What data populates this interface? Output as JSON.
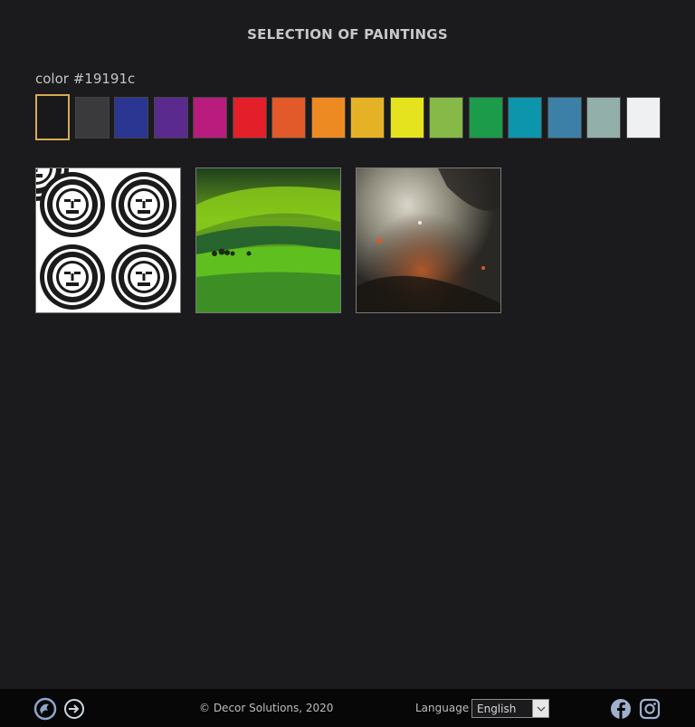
{
  "header": {
    "title": "SELECTION OF PAINTINGS"
  },
  "color_picker": {
    "label": "color #19191c",
    "selected": "#19191c",
    "swatches": [
      "#19191c",
      "#3a3a3c",
      "#2b3592",
      "#5a2a8e",
      "#b81d7e",
      "#e3202a",
      "#e2592a",
      "#ed8b22",
      "#e6b225",
      "#e5e31e",
      "#86b948",
      "#1c9b4b",
      "#0c95ab",
      "#3d80a7",
      "#93afa9",
      "#eff0f2"
    ]
  },
  "gallery": {
    "paintings": [
      {
        "icon": "tribal-sun-masks-painting"
      },
      {
        "icon": "green-hills-landscape-painting"
      },
      {
        "icon": "abstract-rust-texture-painting"
      }
    ]
  },
  "footer": {
    "copyright": "© Decor Solutions, 2020",
    "language_label": "Language",
    "language_value": "English",
    "icons": [
      "logo-icon",
      "login-icon",
      "facebook-icon",
      "instagram-icon"
    ]
  }
}
